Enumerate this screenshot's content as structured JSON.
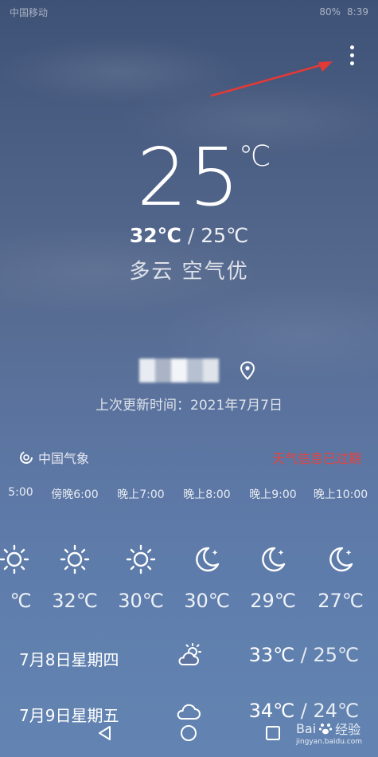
{
  "status_bar": {
    "carrier": "中国移动",
    "battery": "80%",
    "time": "8:39"
  },
  "current": {
    "temperature": "25",
    "unit": "℃",
    "high": "32℃",
    "low": "25℃",
    "separator": "/",
    "condition": "多云  空气优"
  },
  "location": {
    "updated": "上次更新时间：2021年7月7日"
  },
  "source": {
    "name": "中国气象",
    "expired": "天气信息已过期"
  },
  "hourly": [
    {
      "time": "5:00",
      "icon": "sun-icon",
      "temp": "℃"
    },
    {
      "time": "傍晚6:00",
      "icon": "sun-icon",
      "temp": "32℃"
    },
    {
      "time": "晚上7:00",
      "icon": "sun-icon",
      "temp": "30℃"
    },
    {
      "time": "晚上8:00",
      "icon": "moon-icon",
      "temp": "30℃"
    },
    {
      "time": "晚上9:00",
      "icon": "moon-icon",
      "temp": "29℃"
    },
    {
      "time": "晚上10:00",
      "icon": "moon-icon",
      "temp": "27℃"
    }
  ],
  "daily": [
    {
      "date": "7月8日星期四",
      "icon": "partly-sunny-icon",
      "high": "33℃",
      "low": "25℃",
      "separator": "/"
    },
    {
      "date": "7月9日星期五",
      "icon": "cloud-icon",
      "high": "34℃",
      "low": "24℃",
      "separator": "/"
    }
  ],
  "watermark": {
    "brand": "Bai",
    "brand_suffix": "经验",
    "url": "jingyan.baidu.com"
  },
  "colors": {
    "expired": "#e4443e",
    "arrow": "#e53935"
  }
}
